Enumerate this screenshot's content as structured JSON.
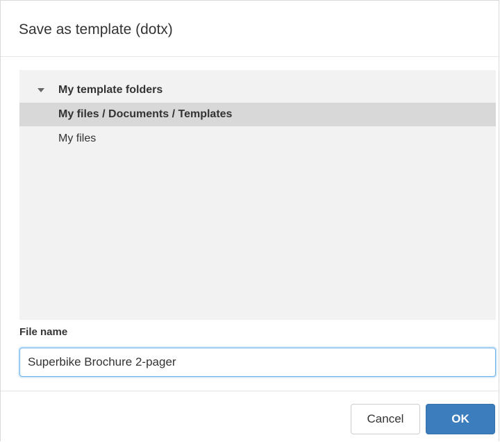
{
  "dialog": {
    "title": "Save as template (dotx)"
  },
  "folder_tree": {
    "root": {
      "label": "My template folders",
      "expanded": true,
      "icon": "caret-down-icon"
    },
    "items": [
      {
        "label": "My files / Documents / Templates",
        "selected": true
      },
      {
        "label": "My files",
        "selected": false
      }
    ]
  },
  "file_name": {
    "label": "File name",
    "value": "Superbike Brochure 2-pager"
  },
  "buttons": {
    "cancel_label": "Cancel",
    "ok_label": "OK"
  },
  "colors": {
    "primary": "#3c7dbe",
    "panel_background": "#f2f2f2",
    "selected_row": "#d8d8d8",
    "focus_border": "#66afe9"
  }
}
